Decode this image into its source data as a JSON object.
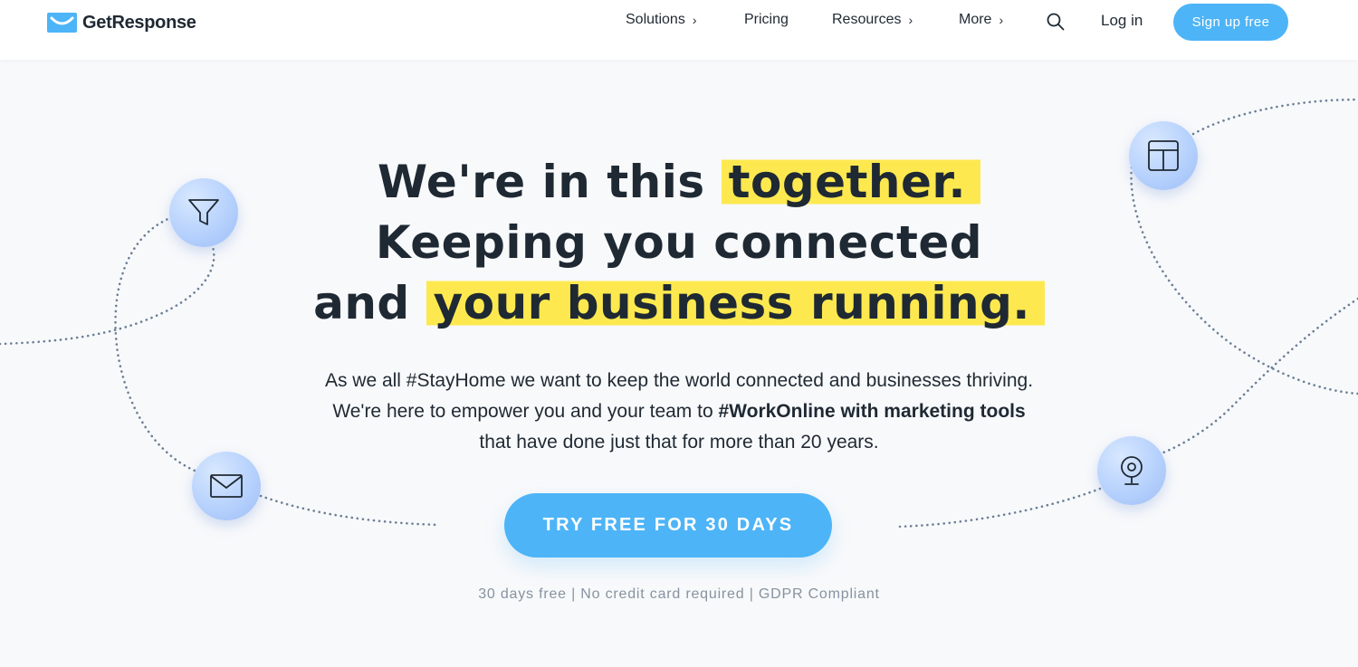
{
  "header": {
    "brand": "GetResponse",
    "nav": [
      {
        "label": "Solutions",
        "has_chevron": true
      },
      {
        "label": "Pricing",
        "has_chevron": false
      },
      {
        "label": "Resources",
        "has_chevron": true
      },
      {
        "label": "More",
        "has_chevron": true
      }
    ],
    "search_icon": "search-icon",
    "login_label": "Log in",
    "signup_label": "Sign up free"
  },
  "hero": {
    "headline": {
      "line1_plain": "We're in this ",
      "line1_highlight": "together.",
      "line2_plain": "Keeping you connected",
      "line3_plain": "and ",
      "line3_highlight": "your business running."
    },
    "sub": {
      "line1": "As we all #StayHome we want to keep the world connected and businesses thriving.",
      "line2_plain": "We're here to empower you and your team to ",
      "line2_bold": "#WorkOnline with marketing tools",
      "line3": "that have done just that for more than 20 years."
    },
    "cta_label": "TRY FREE FOR 30 DAYS",
    "note": "30 days free | No credit card required | GDPR Compliant"
  },
  "decorations": {
    "icons": [
      "funnel-icon",
      "envelope-icon",
      "layout-icon",
      "webcam-icon"
    ]
  },
  "colors": {
    "accent": "#4db4f7",
    "highlight": "#fde94f",
    "text": "#1f2933",
    "muted": "#8693a0",
    "bubble": "#b3cffc"
  }
}
